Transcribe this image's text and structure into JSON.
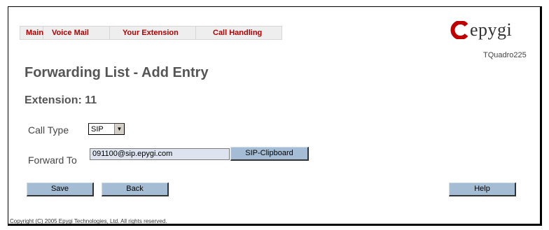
{
  "nav": {
    "items": [
      "Main",
      "Voice Mail",
      "Your Extension",
      "Call Handling"
    ]
  },
  "brand": {
    "logo_text": "epygi",
    "model": "TQuadro225",
    "accent": "#b00000"
  },
  "page": {
    "title": "Forwarding List - Add Entry",
    "subtitle": "Extension: 11"
  },
  "form": {
    "call_type_label": "Call Type",
    "call_type_value": "SIP",
    "forward_to_label": "Forward To",
    "forward_to_value": "091100@sip.epygi.com",
    "clipboard_button": "SIP-Clipboard"
  },
  "buttons": {
    "save": "Save",
    "back": "Back",
    "help": "Help"
  },
  "footer": {
    "copyright": "Copyright (C) 2005 Epygi Technologies, Ltd. All rights reserved."
  }
}
